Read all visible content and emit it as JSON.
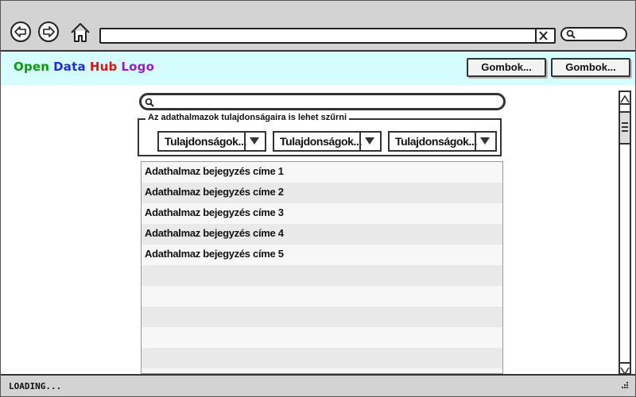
{
  "header": {
    "logo": [
      {
        "text": "Open",
        "color": "#0a9a0a"
      },
      {
        "text": "Data",
        "color": "#1e2fd6"
      },
      {
        "text": "Hub",
        "color": "#e01414"
      },
      {
        "text": "Logo",
        "color": "#9a19d6"
      }
    ],
    "buttons": [
      "Gombok...",
      "Gombok..."
    ]
  },
  "search": {
    "placeholder": ""
  },
  "filter": {
    "legend": "Az adathalmazok tulajdonságaira is lehet szűrni",
    "dropdowns": [
      "Tulajdonságok...",
      "Tulajdonságok...",
      "Tulajdonságok..."
    ]
  },
  "list": {
    "items": [
      "Adathalmaz bejegyzés címe 1",
      "Adathalmaz bejegyzés címe 2",
      "Adathalmaz bejegyzés címe 3",
      "Adathalmaz bejegyzés címe 4",
      "Adathalmaz bejegyzés címe 5",
      "",
      "",
      "",
      "",
      "",
      ""
    ]
  },
  "status": {
    "text": "LOADING..."
  },
  "icons": [
    "back-arrow-icon",
    "forward-arrow-icon",
    "home-icon",
    "clear-icon",
    "search-icon",
    "chevron-down-icon",
    "resize-grip-icon"
  ]
}
